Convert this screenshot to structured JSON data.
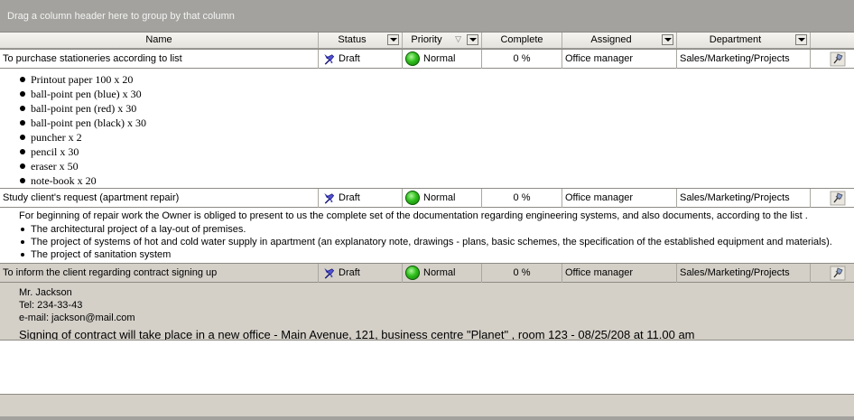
{
  "group_panel": {
    "hint": "Drag a column header here to group by that column"
  },
  "columns": {
    "name": "Name",
    "status": "Status",
    "priority": "Priority",
    "complete": "Complete",
    "assigned": "Assigned",
    "department": "Department"
  },
  "rows": [
    {
      "name": "To purchase stationeries according to list",
      "status": "Draft",
      "priority": "Normal",
      "complete": "0 %",
      "assigned": "Office manager",
      "department": "Sales/Marketing/Projects",
      "preview": {
        "items": [
          "Printout paper 100 x 20",
          "ball-point pen (blue) x 30",
          "ball-point pen (red) x 30",
          "ball-point pen (black) x 30",
          "puncher x 2",
          "pencil x 30",
          "eraser x 50",
          "note-book x 20"
        ]
      }
    },
    {
      "name": "Study client's request (apartment repair)",
      "status": "Draft",
      "priority": "Normal",
      "complete": "0 %",
      "assigned": "Office manager",
      "department": "Sales/Marketing/Projects",
      "preview": {
        "intro": "For beginning of repair work the Owner is obliged to present to us the complete set of the documentation regarding engineering systems, and also documents, according to the list .",
        "items": [
          "The architectural project of a lay-out of premises.",
          "The project of systems of hot and cold water supply in apartment (an explanatory note, drawings - plans, basic schemes, the specification of the established equipment and materials).",
          "The project of sanitation system"
        ]
      }
    },
    {
      "name": "To inform the client regarding contract signing up",
      "status": "Draft",
      "priority": "Normal",
      "complete": "0 %",
      "assigned": "Office manager",
      "department": "Sales/Marketing/Projects",
      "preview": {
        "lines": [
          "Mr. Jackson",
          "Tel: 234-33-43",
          "e-mail: jackson@mail.com"
        ],
        "note": "Signing of contract will take place in a new office - Main Avenue, 121, business centre \"Planet\" , room 123  - 08/25/208 at 11.00 am"
      }
    }
  ],
  "icons": {
    "status": "draft-pin-icon",
    "priority": "green-ball-icon",
    "attachment": "pushpin-icon"
  },
  "colors": {
    "group_panel": "#a3a29f",
    "alt_row": "#d4d0c8",
    "priority_normal": "#2fbf1d"
  }
}
